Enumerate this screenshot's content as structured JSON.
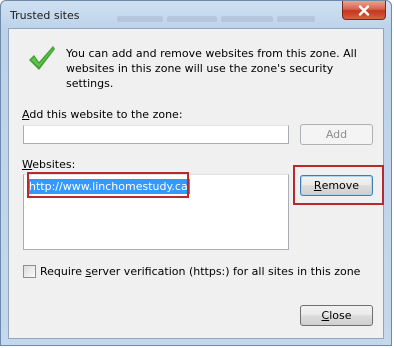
{
  "window": {
    "title": "Trusted sites"
  },
  "info": {
    "message": "You can add and remove websites from this zone. All websites in this zone will use the zone's security settings."
  },
  "add_section": {
    "label_prefix": "",
    "label_accel": "A",
    "label_rest": "dd this website to the zone:",
    "input_value": "",
    "add_button": "Add",
    "add_enabled": false
  },
  "websites_section": {
    "label_accel": "W",
    "label_rest": "ebsites:",
    "sites": [
      "http://www.linchomestudy.ca"
    ],
    "selected_index": 0,
    "remove_accel": "R",
    "remove_rest": "emove"
  },
  "verification": {
    "label_prefix": "Require ",
    "label_accel": "s",
    "label_rest": "erver verification (https:) for all sites in this zone",
    "checked": false
  },
  "footer": {
    "close_accel": "C",
    "close_rest": "lose"
  },
  "colors": {
    "highlight_box": "#b8282e",
    "selection": "#3399ff",
    "checkmark": "#3ea12a"
  },
  "icons": {
    "title_close": "close-icon",
    "info": "checkmark-icon"
  }
}
